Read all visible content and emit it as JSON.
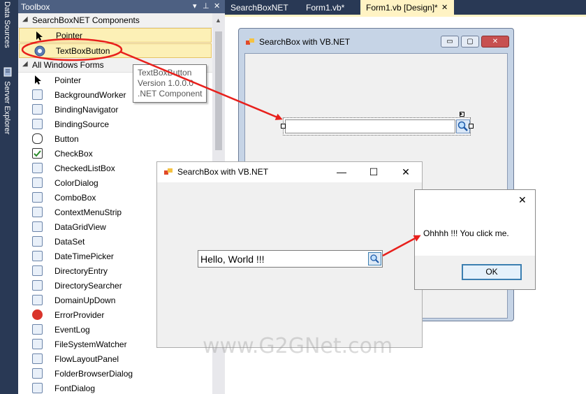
{
  "side_tabs": {
    "data_sources": "Data Sources",
    "server_explorer": "Server Explorer"
  },
  "toolbox": {
    "title": "Toolbox",
    "pin_glyph": "▾ ⊔ ✕",
    "categories": [
      {
        "label": "SearchBoxNET Components"
      },
      {
        "label": "All Windows Forms"
      }
    ],
    "custom_items": [
      {
        "label": "Pointer",
        "icon": "pointer-icon"
      },
      {
        "label": "TextBoxButton",
        "icon": "gear-icon"
      }
    ],
    "items": [
      {
        "label": "Pointer",
        "icon": "pointer-icon"
      },
      {
        "label": "BackgroundWorker",
        "icon": "gears-icon"
      },
      {
        "label": "BindingNavigator",
        "icon": "navigator-icon"
      },
      {
        "label": "BindingSource",
        "icon": "binding-icon"
      },
      {
        "label": "Button",
        "icon": "button-icon"
      },
      {
        "label": "CheckBox",
        "icon": "checkbox-icon"
      },
      {
        "label": "CheckedListBox",
        "icon": "checked-list-icon"
      },
      {
        "label": "ColorDialog",
        "icon": "palette-icon"
      },
      {
        "label": "ComboBox",
        "icon": "combobox-icon"
      },
      {
        "label": "ContextMenuStrip",
        "icon": "menu-icon"
      },
      {
        "label": "DataGridView",
        "icon": "grid-icon"
      },
      {
        "label": "DataSet",
        "icon": "dataset-icon"
      },
      {
        "label": "DateTimePicker",
        "icon": "calendar-icon"
      },
      {
        "label": "DirectoryEntry",
        "icon": "directory-icon"
      },
      {
        "label": "DirectorySearcher",
        "icon": "search-directory-icon"
      },
      {
        "label": "DomainUpDown",
        "icon": "updown-icon"
      },
      {
        "label": "ErrorProvider",
        "icon": "error-icon"
      },
      {
        "label": "EventLog",
        "icon": "eventlog-icon"
      },
      {
        "label": "FileSystemWatcher",
        "icon": "watcher-icon"
      },
      {
        "label": "FlowLayoutPanel",
        "icon": "flowpanel-icon"
      },
      {
        "label": "FolderBrowserDialog",
        "icon": "folder-icon"
      },
      {
        "label": "FontDialog",
        "icon": "font-icon"
      }
    ]
  },
  "tooltip": {
    "line1": "TextBoxButton",
    "line2": "Version 1.0.0.0",
    "line3": ".NET Component"
  },
  "tabs": [
    {
      "label": "SearchBoxNET"
    },
    {
      "label": "Form1.vb*"
    },
    {
      "label": "Form1.vb [Design]*"
    }
  ],
  "tab_close_glyph": "✕",
  "designer_form": {
    "title": "SearchBox with VB.NET",
    "min": "▭",
    "max": "▢",
    "close": "✕"
  },
  "running_form": {
    "title": "SearchBox with VB.NET",
    "min": "—",
    "max": "☐",
    "close": "✕",
    "textbox_value": "Hello, World !!!"
  },
  "message_box": {
    "close": "✕",
    "message": "Ohhhh !!! You click me.",
    "ok_label": "OK"
  },
  "watermark": "www.G2GNet.com",
  "colors": {
    "ide_background": "#293955",
    "toolbox_title": "#4d6082",
    "active_tab": "#fff3c4",
    "annotation_red": "#e8201c"
  }
}
